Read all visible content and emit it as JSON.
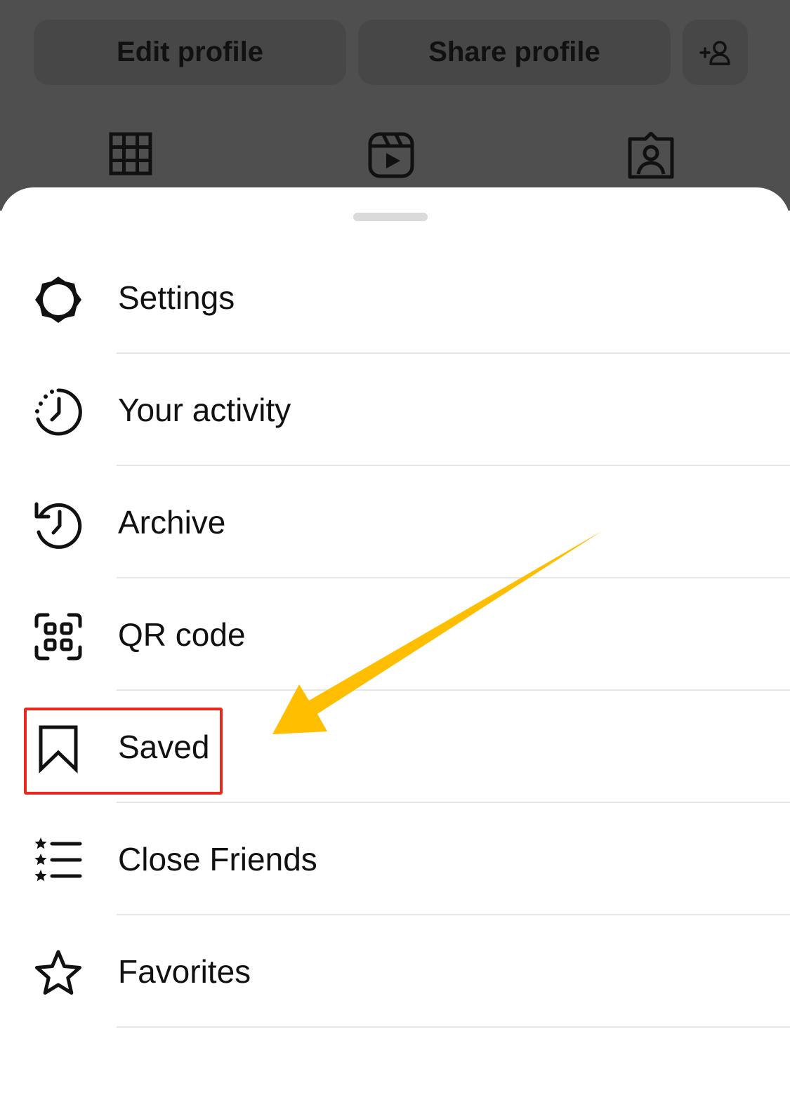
{
  "profile": {
    "edit_label": "Edit profile",
    "share_label": "Share profile",
    "add_person_icon": "add-person-icon",
    "tabs": [
      {
        "icon": "grid-icon"
      },
      {
        "icon": "reels-icon"
      },
      {
        "icon": "tagged-icon"
      }
    ]
  },
  "menu": {
    "items": [
      {
        "label": "Settings",
        "icon": "gear-icon"
      },
      {
        "label": "Your activity",
        "icon": "activity-clock-icon"
      },
      {
        "label": "Archive",
        "icon": "archive-icon"
      },
      {
        "label": "QR code",
        "icon": "qr-code-icon"
      },
      {
        "label": "Saved",
        "icon": "bookmark-icon"
      },
      {
        "label": "Close Friends",
        "icon": "close-friends-icon"
      },
      {
        "label": "Favorites",
        "icon": "star-icon"
      }
    ]
  },
  "annotations": {
    "highlight_color": "#e8271e",
    "arrow_color": "#ffbf00"
  }
}
